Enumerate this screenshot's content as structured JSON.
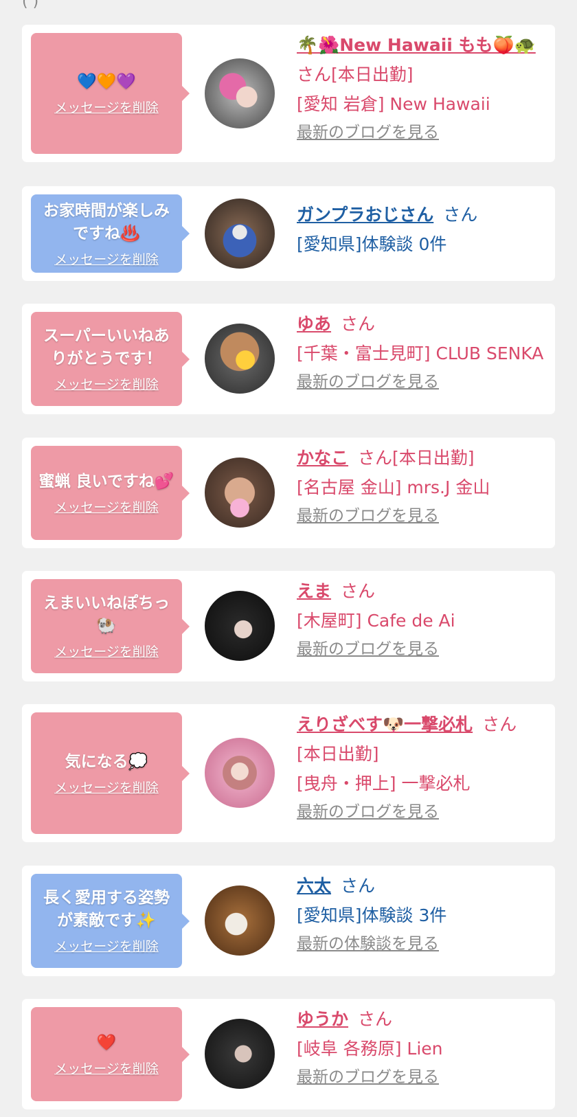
{
  "delete_label": "メッセージを削除",
  "cards": [
    {
      "message": "💙🧡💜",
      "name": "🌴🌺New Hawaii もも🍑🐢",
      "suffix": "",
      "line2": "さん[本日出勤]",
      "line3": "[愛知 岩倉] New Hawaii",
      "blog": "最新のブログを見る"
    },
    {
      "message": "お家時間が楽しみですね♨️",
      "name": "ガンプラおじさん",
      "suffix": "さん",
      "line2": "[愛知県]体験談 0件",
      "line3": "",
      "blog": ""
    },
    {
      "message": "スーパーいいねありがとうです！",
      "name": "ゆあ",
      "suffix": "さん",
      "line2": "[千葉・富士見町] CLUB SENKA",
      "line3": "",
      "blog": "最新のブログを見る"
    },
    {
      "message": "蜜蝋 良いですね💕",
      "name": "かなこ",
      "suffix": "さん[本日出勤]",
      "line2": "[名古屋 金山] mrs.J 金山",
      "line3": "",
      "blog": "最新のブログを見る"
    },
    {
      "message": "えまいいねぽちっ🐏",
      "name": "えま",
      "suffix": "さん",
      "line2": "[木屋町] Cafe de Ai",
      "line3": "",
      "blog": "最新のブログを見る"
    },
    {
      "message": "気になる💭",
      "name": "えりざべす🐶一撃必札",
      "suffix": "さん",
      "line2": "[本日出勤]",
      "line3": "[曳舟・押上] 一撃必札",
      "blog": "最新のブログを見る"
    },
    {
      "message": "長く愛用する姿勢が素敵です✨",
      "name": "六太",
      "suffix": "さん",
      "line2": "[愛知県]体験談 3件",
      "line3": "",
      "blog": "最新の体験談を見る"
    },
    {
      "message": "❤️",
      "name": "ゆうか",
      "suffix": "さん",
      "line2": "[岐阜 各務原] Lien",
      "line3": "",
      "blog": "最新のブログを見る"
    }
  ]
}
